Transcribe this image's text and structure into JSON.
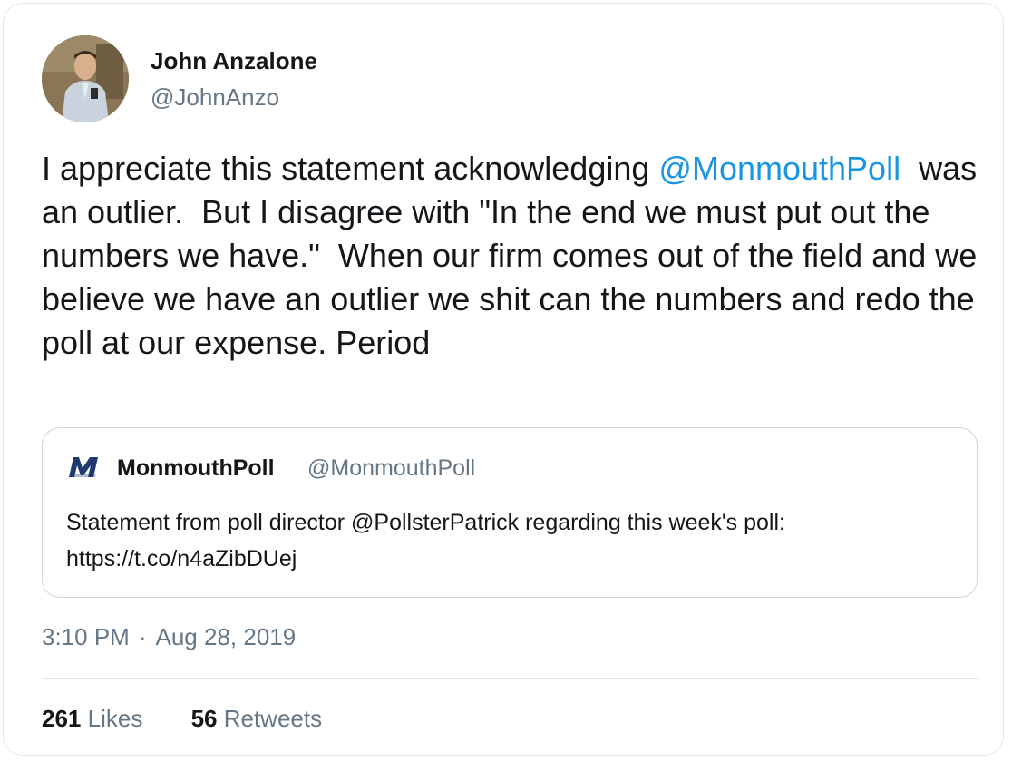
{
  "author": {
    "name": "John Anzalone",
    "handle": "@JohnAnzo",
    "avatar_icon": "profile-photo"
  },
  "tweet": {
    "text_before": "I appreciate this statement acknowledging ",
    "mention": "@MonmouthPoll",
    "text_after": "  was an outlier.  But I disagree with \"In the end we must put out the numbers we have.\"  When our firm comes out of the field and we believe we have an outlier we shit can the numbers and redo the poll at our expense. Period"
  },
  "quoted_tweet": {
    "logo_icon": "monmouth-m-logo",
    "name": "MonmouthPoll",
    "handle": "@MonmouthPoll",
    "text": "Statement from poll director @PollsterPatrick regarding this week's poll: https://t.co/n4aZibDUej"
  },
  "meta": {
    "time": "3:10 PM",
    "separator": "·",
    "date": "Aug 28, 2019"
  },
  "stats": {
    "likes_count": "261",
    "likes_label": "Likes",
    "retweets_count": "56",
    "retweets_label": "Retweets"
  },
  "colors": {
    "mention": "#1b95e0",
    "secondary_text": "#657786",
    "border": "#e1e8ed",
    "logo": "#1f3a6e"
  }
}
